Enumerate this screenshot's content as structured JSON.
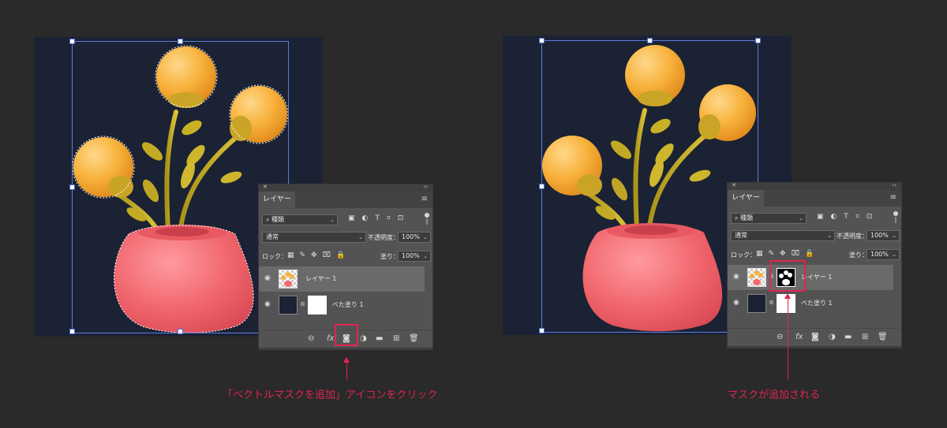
{
  "left_panel": {
    "tab_label": "レイヤー",
    "filter_kind": "種類",
    "blend_mode": "通常",
    "opacity_label": "不透明度：",
    "opacity_value": "100%",
    "lock_label": "ロック：",
    "fill_label": "塗り：",
    "fill_value": "100%",
    "layers": [
      {
        "name": "レイヤー 1",
        "selected": true
      },
      {
        "name": "べた塗り 1",
        "selected": false
      }
    ]
  },
  "right_panel": {
    "tab_label": "レイヤー",
    "filter_kind": "種類",
    "blend_mode": "通常",
    "opacity_label": "不透明度：",
    "opacity_value": "100%",
    "lock_label": "ロック：",
    "fill_label": "塗り：",
    "fill_value": "100%",
    "layers": [
      {
        "name": "レイヤー 1",
        "selected": true
      },
      {
        "name": "べた塗り 1",
        "selected": false
      }
    ]
  },
  "captions": {
    "left": "「ベクトルマスクを追加」アイコンをクリック",
    "right": "マスクが追加される"
  },
  "colors": {
    "canvas_bg": "#1b2233",
    "accent_red": "#e0254f",
    "vase": "#f06a6f",
    "flower": "#f6b13c",
    "stem": "#c7b02a"
  },
  "icons": {
    "eye": "eye-icon",
    "link": "link-icon",
    "fx": "fx-icon",
    "mask": "add-vector-mask-icon",
    "adjustment": "adjustment-layer-icon",
    "folder": "folder-icon",
    "new_layer": "new-layer-icon",
    "trash": "trash-icon"
  }
}
